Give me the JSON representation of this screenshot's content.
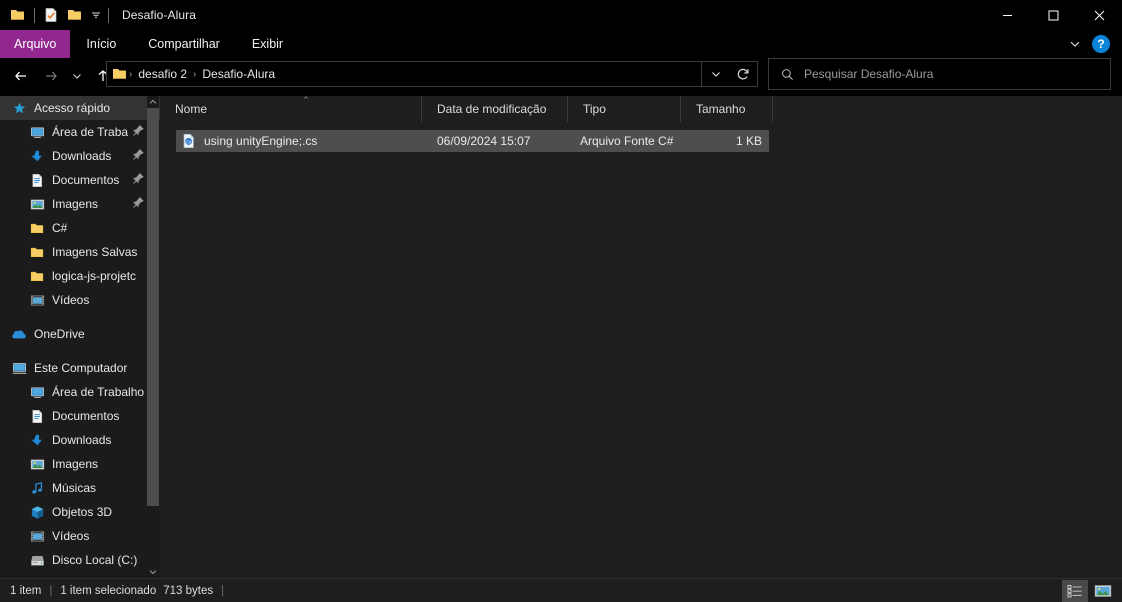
{
  "window": {
    "title": "Desafio-Alura",
    "controls": {
      "minimize": "–",
      "maximize": "□",
      "close": "✕"
    }
  },
  "quick_access_toolbar": {
    "items": [
      {
        "name": "folder-icon",
        "label": "Propriedades da pasta"
      },
      {
        "name": "properties-icon",
        "label": "Propriedades"
      },
      {
        "name": "new-folder-icon",
        "label": "Nova pasta"
      },
      {
        "name": "customize-chevron-icon",
        "label": "Personalizar Barra de Ferramentas de Acesso Rápido"
      }
    ]
  },
  "ribbon": {
    "tabs": [
      {
        "label": "Arquivo",
        "active": true
      },
      {
        "label": "Início",
        "active": false
      },
      {
        "label": "Compartilhar",
        "active": false
      },
      {
        "label": "Exibir",
        "active": false
      }
    ],
    "expand_label": "⌄",
    "help_label": "?",
    "accent_color": "#92278f"
  },
  "navigation": {
    "back": "←",
    "forward": "→",
    "recent": "⌄",
    "up": "↑",
    "breadcrumbs": [
      {
        "label": "desafio 2"
      },
      {
        "label": "Desafio-Alura"
      }
    ],
    "separator": "›",
    "dropdown": "⌄",
    "refresh": "↻"
  },
  "search": {
    "placeholder": "Pesquisar Desafio-Alura",
    "icon": "search-icon"
  },
  "sidebar": {
    "groups": [
      {
        "name": "quick-access",
        "header": {
          "label": "Acesso rápido",
          "icon": "star-icon",
          "selected": true
        },
        "items": [
          {
            "label": "Área de Traba",
            "icon": "desktop-icon",
            "pinned": true
          },
          {
            "label": "Downloads",
            "icon": "download-icon",
            "pinned": true
          },
          {
            "label": "Documentos",
            "icon": "documents-icon",
            "pinned": true
          },
          {
            "label": "Imagens",
            "icon": "pictures-icon",
            "pinned": true
          },
          {
            "label": "C#",
            "icon": "folder-icon",
            "pinned": false
          },
          {
            "label": "Imagens Salvas",
            "icon": "folder-icon",
            "pinned": false
          },
          {
            "label": "logica-js-projetc",
            "icon": "folder-icon",
            "pinned": false
          },
          {
            "label": "Vídeos",
            "icon": "videos-icon",
            "pinned": false
          }
        ]
      },
      {
        "name": "onedrive",
        "header": {
          "label": "OneDrive",
          "icon": "onedrive-icon",
          "selected": false
        },
        "items": []
      },
      {
        "name": "this-pc",
        "header": {
          "label": "Este Computador",
          "icon": "computer-icon",
          "selected": false
        },
        "items": [
          {
            "label": "Área de Trabalho",
            "icon": "desktop-icon",
            "pinned": false
          },
          {
            "label": "Documentos",
            "icon": "documents-icon",
            "pinned": false
          },
          {
            "label": "Downloads",
            "icon": "download-icon",
            "pinned": false
          },
          {
            "label": "Imagens",
            "icon": "pictures-icon",
            "pinned": false
          },
          {
            "label": "Músicas",
            "icon": "music-icon",
            "pinned": false
          },
          {
            "label": "Objetos 3D",
            "icon": "objects3d-icon",
            "pinned": false
          },
          {
            "label": "Vídeos",
            "icon": "videos-icon",
            "pinned": false
          },
          {
            "label": "Disco Local (C:)",
            "icon": "drive-icon",
            "pinned": false
          }
        ]
      }
    ]
  },
  "file_list": {
    "columns": [
      {
        "label": "Nome",
        "sorted": "asc",
        "sort_glyph": "⌃"
      },
      {
        "label": "Data de modificação",
        "sorted": ""
      },
      {
        "label": "Tipo",
        "sorted": ""
      },
      {
        "label": "Tamanho",
        "sorted": ""
      }
    ],
    "rows": [
      {
        "name": "using unityEngine;.cs",
        "date": "06/09/2024 15:07",
        "type": "Arquivo Fonte C#",
        "size": "1 KB",
        "icon": "csharp-file-icon",
        "selected": true
      }
    ]
  },
  "status_bar": {
    "item_count": "1 item",
    "separator": "|",
    "selection": "1 item selecionado",
    "selection_size": "713 bytes",
    "trailing_separator": "|",
    "views": [
      {
        "name": "details-view-button",
        "active": true
      },
      {
        "name": "large-icons-view-button",
        "active": false
      }
    ]
  }
}
